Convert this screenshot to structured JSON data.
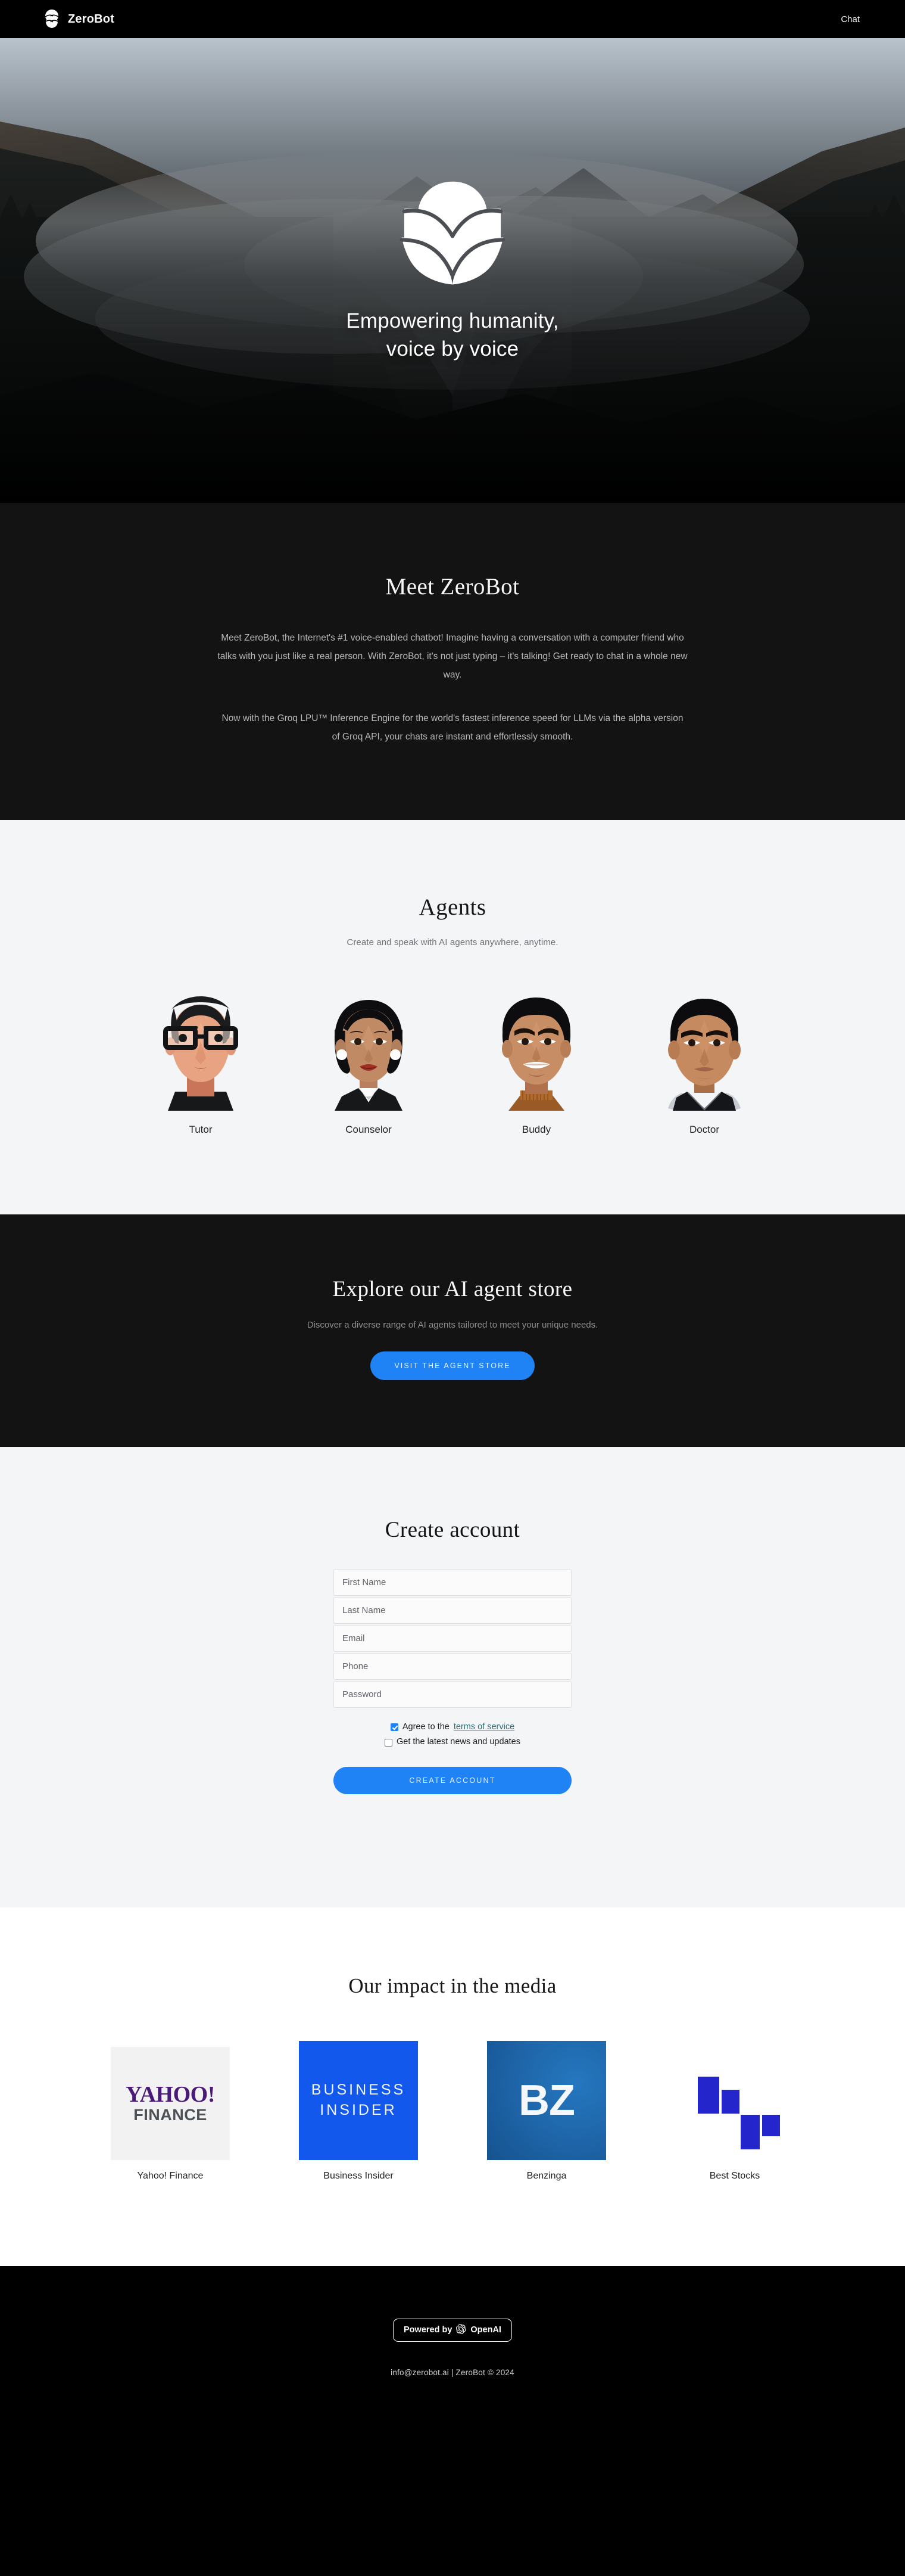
{
  "navbar": {
    "brand": "ZeroBot",
    "brand_icon": "zerobot-leaf-logo-icon",
    "chat_link": "Chat"
  },
  "hero": {
    "logo_icon": "zerobot-leaf-logo-icon",
    "tagline_line1": "Empowering humanity,",
    "tagline_line2": "voice by voice"
  },
  "meet": {
    "title": "Meet ZeroBot",
    "paragraph1": "Meet ZeroBot, the Internet's #1 voice-enabled chatbot! Imagine having a conversation with a computer friend who talks with you just like a real person. With ZeroBot, it's not just typing – it's talking! Get ready to chat in a whole new way.",
    "paragraph2": "Now with the Groq LPU™ Inference Engine for the world's fastest inference speed for LLMs via the alpha version of Groq API, your chats are instant and effortlessly smooth."
  },
  "agents": {
    "title": "Agents",
    "subtitle": "Create and speak with AI agents anywhere, anytime.",
    "items": [
      {
        "name": "Tutor",
        "avatar_icon": "avatar-tutor-glasses-icon"
      },
      {
        "name": "Counselor",
        "avatar_icon": "avatar-counselor-woman-icon"
      },
      {
        "name": "Buddy",
        "avatar_icon": "avatar-buddy-smiling-icon"
      },
      {
        "name": "Doctor",
        "avatar_icon": "avatar-doctor-stethoscope-icon"
      }
    ]
  },
  "store": {
    "title": "Explore our AI agent store",
    "subtitle": "Discover a diverse range of AI agents tailored to meet your unique needs.",
    "button": "VISIT THE AGENT STORE"
  },
  "signup": {
    "title": "Create account",
    "fields": [
      {
        "name": "first-name",
        "placeholder": "First Name",
        "value": ""
      },
      {
        "name": "last-name",
        "placeholder": "Last Name",
        "value": ""
      },
      {
        "name": "email",
        "placeholder": "Email",
        "value": ""
      },
      {
        "name": "phone",
        "placeholder": "Phone",
        "value": ""
      },
      {
        "name": "password",
        "placeholder": "Password",
        "value": ""
      }
    ],
    "terms_prefix": "Agree to the",
    "terms_link": "terms of service",
    "terms_checked": true,
    "news_label": "Get the latest news and updates",
    "news_checked": false,
    "submit": "CREATE ACCOUNT"
  },
  "media": {
    "title": "Our impact in the media",
    "items": [
      {
        "caption": "Yahoo! Finance",
        "logo_icon": "yahoo-finance-logo-icon",
        "line1": "YAHOO!",
        "line2": "FINANCE"
      },
      {
        "caption": "Business Insider",
        "logo_icon": "business-insider-logo-icon",
        "line1": "BUSINESS",
        "line2": "INSIDER"
      },
      {
        "caption": "Benzinga",
        "logo_icon": "benzinga-logo-icon",
        "line1": "BZ",
        "line2": ""
      },
      {
        "caption": "Best Stocks",
        "logo_icon": "best-stocks-bars-logo-icon",
        "line1": "",
        "line2": ""
      }
    ]
  },
  "footer": {
    "powered_prefix": "Powered by",
    "powered_brand": "OpenAI",
    "powered_icon": "openai-logo-icon",
    "copyright": "info@zerobot.ai | ZeroBot © 2024"
  },
  "colors": {
    "accent_blue": "#1f82f5",
    "dark_bg": "#131313",
    "light_bg": "#f4f5f7",
    "business_insider_blue": "#1258ed",
    "benzinga_blue": "#1f67ab",
    "best_stocks_blue": "#2525cc",
    "yahoo_purple": "#4a1a78"
  }
}
